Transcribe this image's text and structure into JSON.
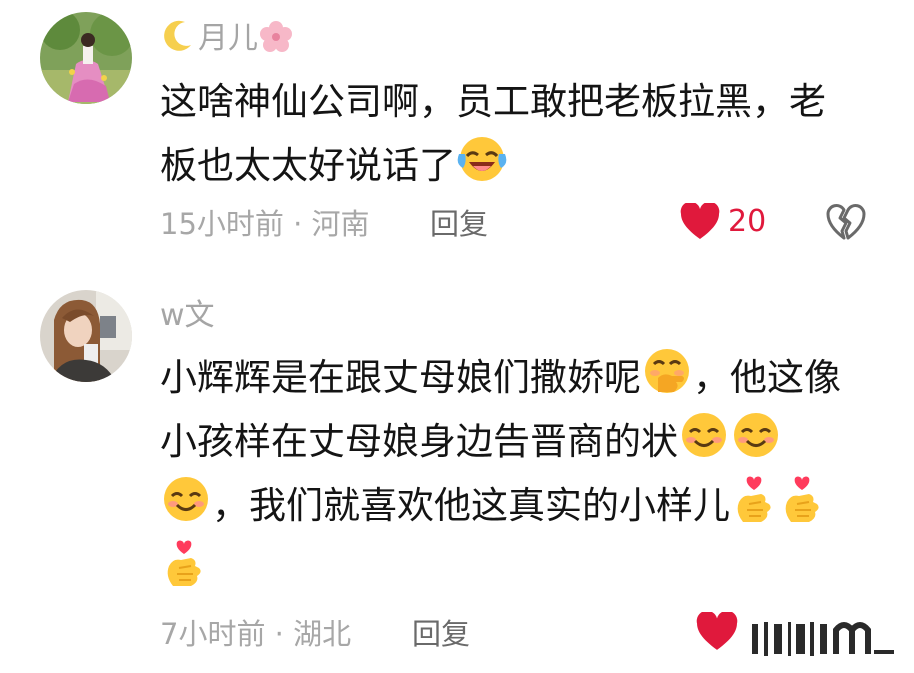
{
  "comments": [
    {
      "username": "月儿",
      "lines": [
        "这啥神仙公司啊，员工敢把老板拉黑，老",
        "板也太太好说话了"
      ],
      "meta": "15小时前 · 河南",
      "reply_label": "回复",
      "like_count": "20",
      "emojis": [
        "crescent-moon",
        "cherry-blossom",
        "laughing-tears"
      ]
    },
    {
      "username": "w文",
      "lines": [
        "小辉辉是在跟丈母娘们撒娇呢",
        "，他这像",
        "小孩样在丈母娘身边告晋商的状",
        "，我们就喜欢他这真实的小样儿"
      ],
      "meta": "7小时前 · 湖北",
      "reply_label": "回复",
      "emojis": [
        "hand-over-mouth",
        "smiling-blush",
        "finger-heart"
      ]
    }
  ],
  "colors": {
    "like_red": "#e0193c",
    "meta_gray": "#a7a7a7",
    "text": "#141414"
  },
  "icons": [
    "heart-icon",
    "broken-heart-icon"
  ]
}
